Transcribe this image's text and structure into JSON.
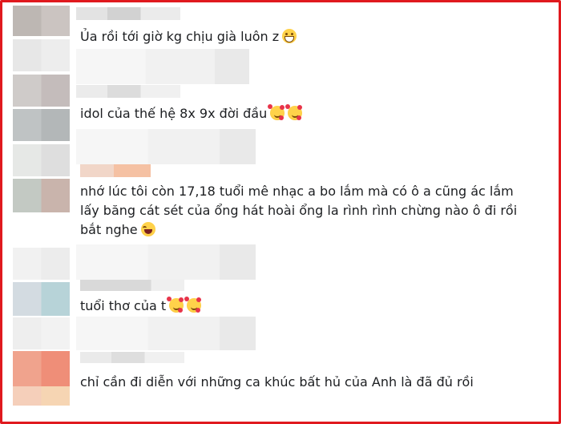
{
  "comments": [
    {
      "text": "Ủa rồi tới giờ kg chịu già luôn z",
      "emojis": [
        "grin"
      ]
    },
    {
      "text": "idol của thế hệ 8x 9x đời đầu",
      "emojis": [
        "love",
        "love"
      ]
    },
    {
      "lines": [
        "nhớ lúc tôi còn 17,18 tuổi mê nhạc a bo lắm mà có ô a cũng ác lắm",
        "lấy băng cát sét của ổng hát hoài ổng la rình rình chừng nào ô đi rồi",
        "bắt nghe"
      ],
      "emojis": [
        "laugh"
      ]
    },
    {
      "text": "tuổi thơ của t",
      "emojis": [
        "love",
        "love"
      ]
    },
    {
      "text": "chỉ cần đi diễn với những ca khúc bất hủ của Anh là đã đủ rồi",
      "emojis": []
    }
  ],
  "colors": {
    "border": "#e0191e",
    "text": "#1c1e21"
  }
}
